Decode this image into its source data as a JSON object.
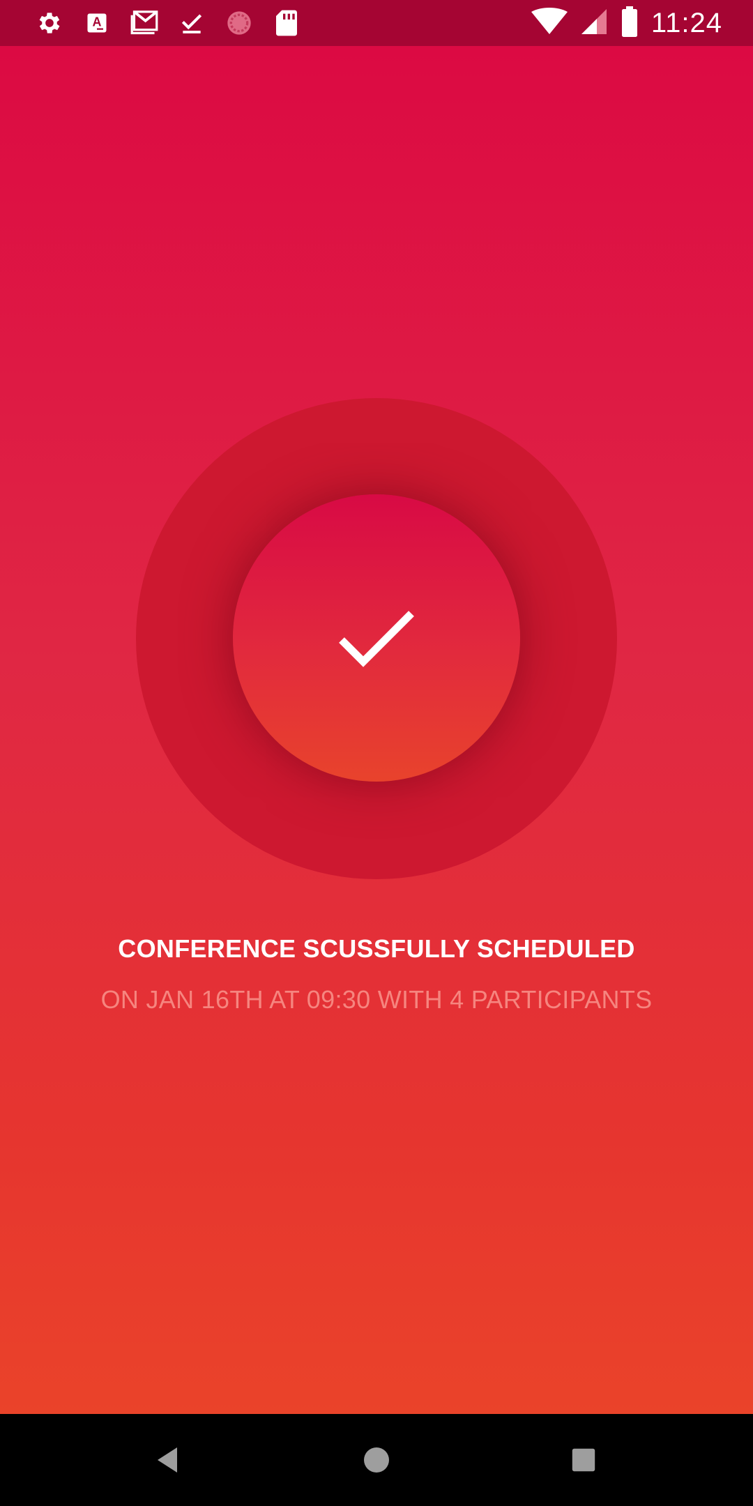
{
  "status_bar": {
    "time": "11:24",
    "background": "#a50533",
    "left_icons": [
      "gear-icon",
      "text-a-icon",
      "gmail-icon",
      "check-download-icon",
      "sync-circle-icon",
      "sd-card-icon"
    ],
    "right_icons": [
      "wifi-icon",
      "cell-signal-icon",
      "battery-icon"
    ]
  },
  "confirmation": {
    "icon": "checkmark-icon",
    "title": "CONFERENCE SCUSSFULLY SCHEDULED",
    "subtitle": "ON JAN 16TH AT 09:30 WITH 4 PARTICIPANTS"
  },
  "colors": {
    "gradient_top": "#dc0a43",
    "gradient_bottom": "#ea432a",
    "ring": "#cd1830",
    "subtitle_text": "#f6857f"
  },
  "nav_bar": {
    "buttons": [
      "back-icon",
      "home-icon",
      "recents-icon"
    ]
  }
}
